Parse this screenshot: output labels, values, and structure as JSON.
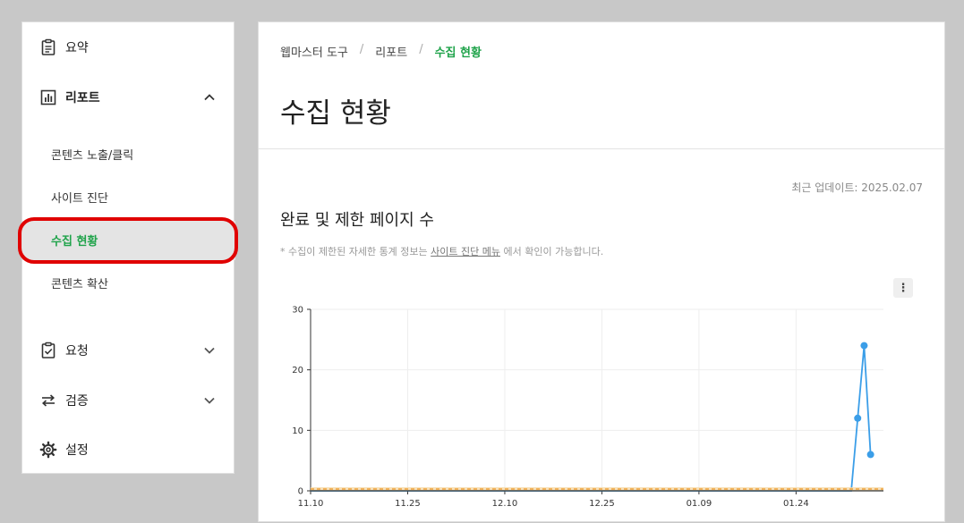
{
  "sidebar": {
    "summary": {
      "label": "요약",
      "icon": "clipboard-icon"
    },
    "reports": {
      "label": "리포트",
      "icon": "bar-chart-icon",
      "expanded": true,
      "items": [
        {
          "label": "콘텐츠 노출/클릭"
        },
        {
          "label": "사이트 진단"
        },
        {
          "label": "수집 현황",
          "active": true
        },
        {
          "label": "콘텐츠 확산"
        }
      ]
    },
    "requests": {
      "label": "요청",
      "icon": "clipboard-check-icon"
    },
    "verify": {
      "label": "검증",
      "icon": "swap-arrows-icon"
    },
    "settings": {
      "label": "설정",
      "icon": "gear-icon"
    }
  },
  "breadcrumb": [
    "웹마스터 도구",
    "리포트",
    "수집 현황"
  ],
  "page_title": "수집 현황",
  "updated": "최근 업데이트: 2025.02.07",
  "section_title": "완료 및 제한 페이지 수",
  "note": {
    "prefix": "* 수집이 제한된 자세한 통계 정보는 ",
    "link": "사이트 진단 메뉴",
    "suffix": " 에서 확인이 가능합니다."
  },
  "menu_glyph": "⋮",
  "colors": {
    "accent": "#1fa34a",
    "series_blue": "#3b9ee8",
    "series_orange": "#f0a33a",
    "highlight": "#e00000"
  },
  "chart_data": {
    "type": "line",
    "x_ticks": [
      "11.10",
      "11.25",
      "12.10",
      "12.25",
      "01.09",
      "01.24"
    ],
    "y_ticks": [
      0,
      10,
      20,
      30
    ],
    "ylim": [
      0,
      30
    ],
    "x_range_days": [
      0,
      89
    ],
    "series": [
      {
        "color": "#3b9ee8",
        "points": [
          [
            0,
            0
          ],
          [
            84,
            0
          ],
          [
            85,
            12
          ],
          [
            86,
            24
          ],
          [
            87,
            6
          ]
        ]
      },
      {
        "color": "#f0a33a",
        "points": [
          [
            0,
            0.3
          ],
          [
            89,
            0.3
          ]
        ]
      }
    ]
  }
}
